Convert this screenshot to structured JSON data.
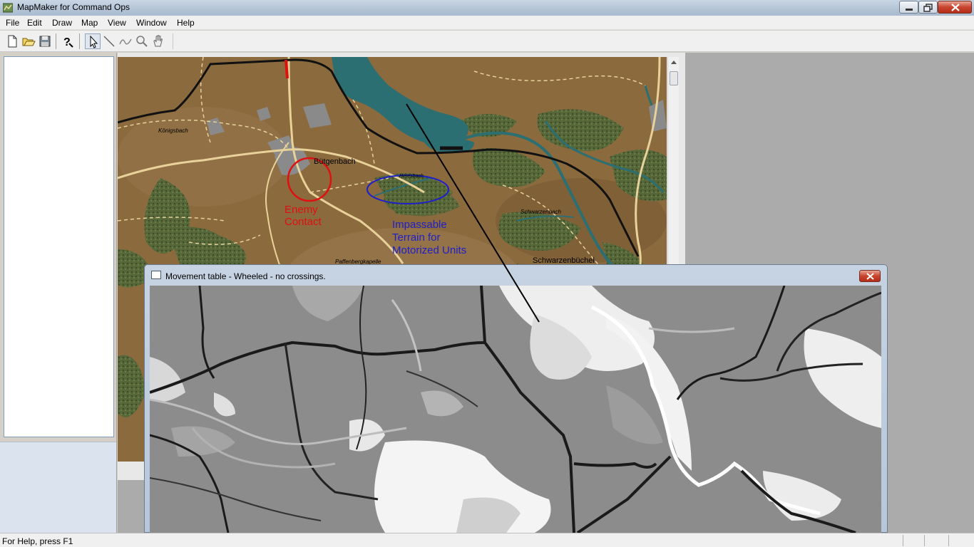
{
  "window": {
    "title": "MapMaker for Command Ops",
    "icon": "mapmaker-app-icon"
  },
  "menu": {
    "items": [
      "File",
      "Edit",
      "Draw",
      "Map",
      "View",
      "Window",
      "Help"
    ]
  },
  "toolbar": {
    "buttons": [
      "new-icon",
      "open-icon",
      "save-icon",
      "help-icon",
      "select-arrow-icon",
      "line-icon",
      "polyline-icon",
      "zoom-icon",
      "pan-hand-icon"
    ]
  },
  "map": {
    "places": {
      "konigsbach": "Königsbach",
      "butgenbach": "Bütgenbach",
      "hevesbach": "Heresbach",
      "schwarzenbach": "Schwarzenbach",
      "schwarzenbuchel": "Schwarzenbüchel",
      "rathe": "Paffenbergkapelle"
    },
    "annotations": {
      "enemy_contact": [
        "Enemy",
        "Contact"
      ],
      "impassable": [
        "Impassable",
        "Terrain for",
        "Motorized Units"
      ]
    },
    "colors": {
      "terrain": "#8b6a3e",
      "water": "#2b6f73",
      "enemy": "#e01010",
      "impassable": "#2020c8"
    }
  },
  "movement_window": {
    "title": "Movement table - Wheeled - no crossings."
  },
  "status": {
    "text": "For Help, press F1"
  }
}
